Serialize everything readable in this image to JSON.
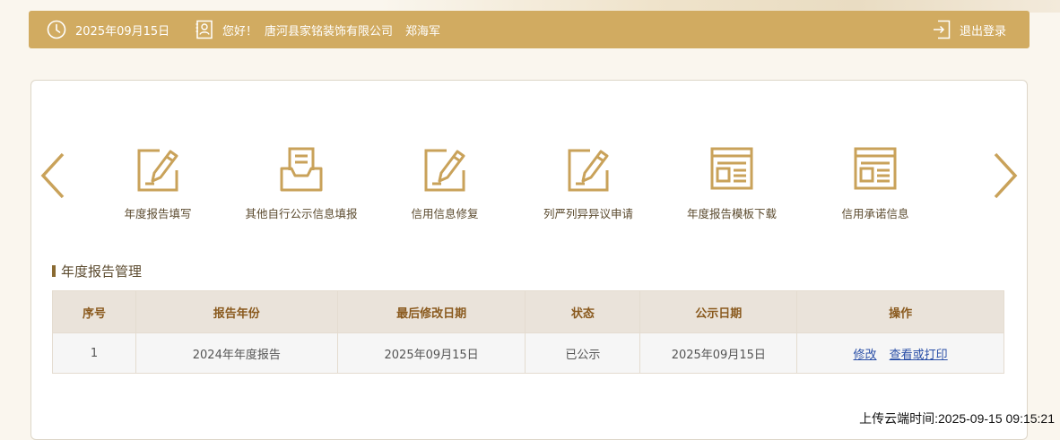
{
  "header": {
    "date": "2025年09月15日",
    "greeting": "您好！",
    "company": "唐河县家铭装饰有限公司",
    "user": "郑海军",
    "logout_label": "退出登录",
    "accent_color": "#d1ab61"
  },
  "nav": {
    "items": [
      {
        "label": "年度报告填写",
        "icon": "edit-form-icon"
      },
      {
        "label": "其他自行公示信息填报",
        "icon": "document-tray-icon"
      },
      {
        "label": "信用信息修复",
        "icon": "edit-form-icon"
      },
      {
        "label": "列严列异异议申请",
        "icon": "edit-form-icon"
      },
      {
        "label": "年度报告模板下载",
        "icon": "template-window-icon"
      },
      {
        "label": "信用承诺信息",
        "icon": "template-window-icon"
      }
    ]
  },
  "section": {
    "title": "年度报告管理"
  },
  "table": {
    "headers": [
      "序号",
      "报告年份",
      "最后修改日期",
      "状态",
      "公示日期",
      "操作"
    ],
    "rows": [
      {
        "index": "1",
        "year": "2024年年度报告",
        "modified": "2025年09月15日",
        "status": "已公示",
        "publish_date": "2025年09月15日",
        "actions": [
          "修改",
          "查看或打印"
        ]
      }
    ]
  },
  "footer": {
    "upload_time": "上传云端时间:2025-09-15 09:15:21"
  }
}
